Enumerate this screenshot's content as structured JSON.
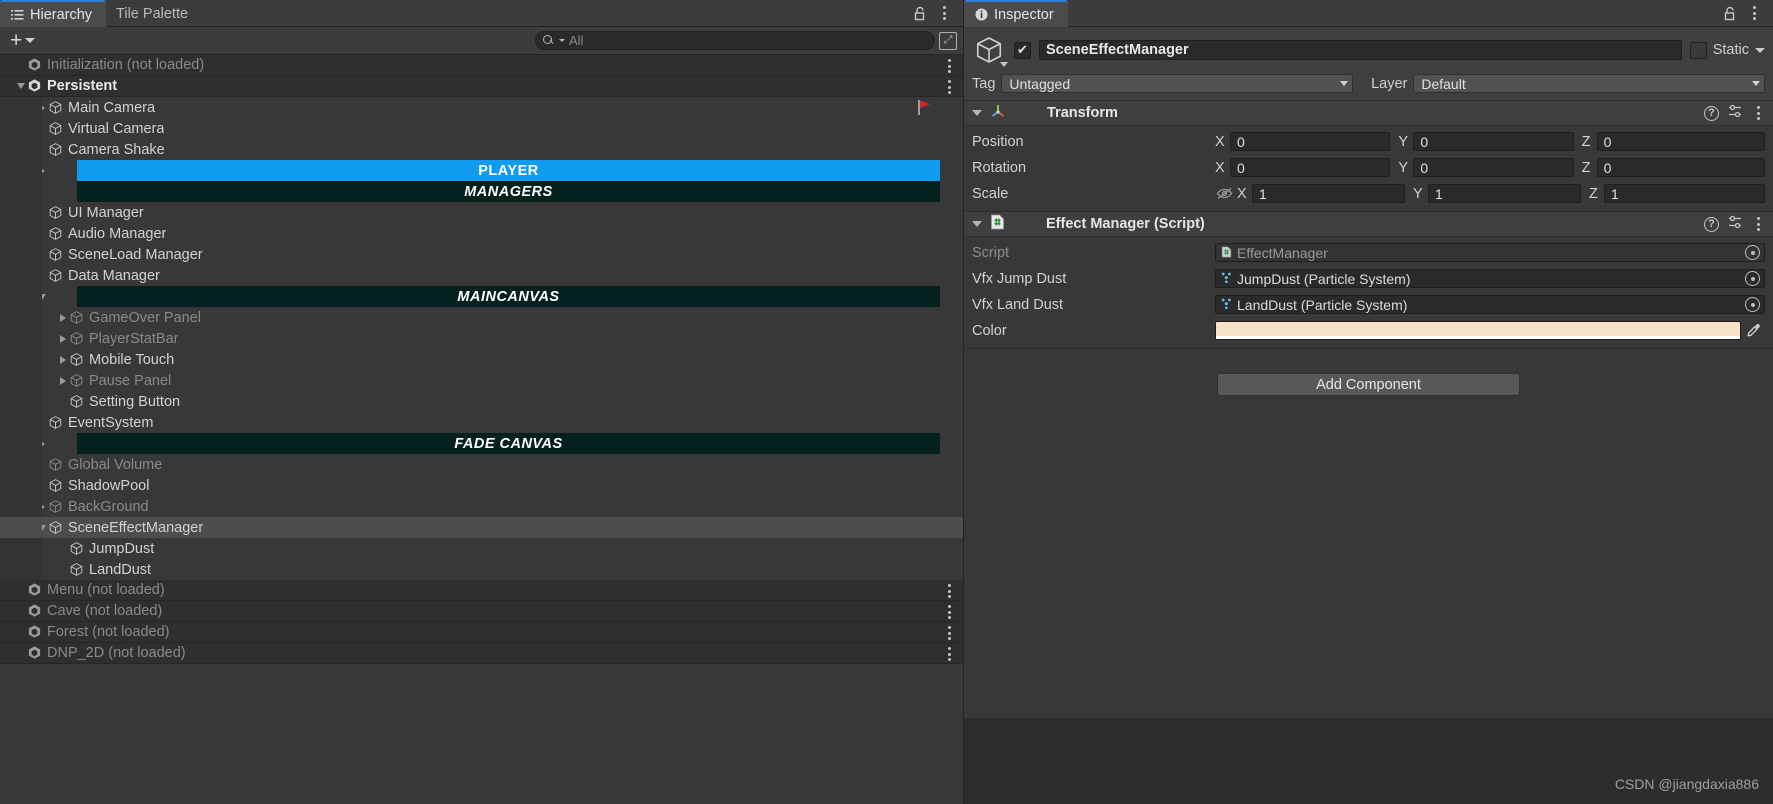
{
  "hierarchy": {
    "tabs": [
      {
        "label": "Hierarchy",
        "icon": "hierarchy-list-icon",
        "active": true
      },
      {
        "label": "Tile Palette",
        "icon": "tile-palette-icon",
        "active": false
      }
    ],
    "lock_icon": "lock-open-icon",
    "menu_icon": "kebab-menu-icon",
    "toolbar": {
      "add_label": "+",
      "add_icon": "plus-icon",
      "dropdown_icon": "chevron-down-icon"
    },
    "search": {
      "placeholder": "All",
      "value": "",
      "icon": "search-icon",
      "expand_icon": "expand-search-icon"
    },
    "rows": [
      {
        "label": "Initialization (not loaded)",
        "type": "scene",
        "depth": 0,
        "dim": true,
        "tri": "none",
        "icon": "unity-scene-icon",
        "kebab": true
      },
      {
        "label": "Persistent",
        "type": "scene-loaded",
        "depth": 0,
        "dim": false,
        "tri": "open",
        "icon": "unity-scene-icon",
        "kebab": true
      },
      {
        "label": "Main Camera",
        "type": "go",
        "depth": 1,
        "dim": false,
        "tri": "closed",
        "icon": "gameobject-icon",
        "flag": "camera-preview-flag"
      },
      {
        "label": "Virtual Camera",
        "type": "go",
        "depth": 1,
        "dim": false,
        "tri": "none",
        "icon": "gameobject-icon"
      },
      {
        "label": "Camera Shake",
        "type": "go",
        "depth": 1,
        "dim": false,
        "tri": "none",
        "icon": "gameobject-icon"
      },
      {
        "label": "PLAYER",
        "type": "banner-blue",
        "depth": 1,
        "dim": false,
        "tri": "closed",
        "icon": "none"
      },
      {
        "label": "MANAGERS",
        "type": "banner-teal",
        "depth": 1,
        "dim": false,
        "tri": "none",
        "icon": "none"
      },
      {
        "label": "UI Manager",
        "type": "go",
        "depth": 1,
        "dim": false,
        "tri": "none",
        "icon": "gameobject-icon"
      },
      {
        "label": "Audio Manager",
        "type": "go",
        "depth": 1,
        "dim": false,
        "tri": "none",
        "icon": "gameobject-icon"
      },
      {
        "label": "SceneLoad Manager",
        "type": "go",
        "depth": 1,
        "dim": false,
        "tri": "none",
        "icon": "gameobject-icon"
      },
      {
        "label": "Data Manager",
        "type": "go",
        "depth": 1,
        "dim": false,
        "tri": "none",
        "icon": "gameobject-icon"
      },
      {
        "label": "MAINCANVAS",
        "type": "banner-teal",
        "depth": 1,
        "dim": false,
        "tri": "open",
        "icon": "none"
      },
      {
        "label": "GameOver Panel",
        "type": "go",
        "depth": 2,
        "dim": true,
        "tri": "closed",
        "icon": "gameobject-icon"
      },
      {
        "label": "PlayerStatBar",
        "type": "go",
        "depth": 2,
        "dim": true,
        "tri": "closed",
        "icon": "gameobject-icon"
      },
      {
        "label": "Mobile Touch",
        "type": "go",
        "depth": 2,
        "dim": false,
        "tri": "closed",
        "icon": "gameobject-icon"
      },
      {
        "label": "Pause Panel",
        "type": "go",
        "depth": 2,
        "dim": true,
        "tri": "closed",
        "icon": "gameobject-icon"
      },
      {
        "label": "Setting Button",
        "type": "go",
        "depth": 2,
        "dim": false,
        "tri": "none",
        "icon": "gameobject-icon"
      },
      {
        "label": "EventSystem",
        "type": "go",
        "depth": 1,
        "dim": false,
        "tri": "none",
        "icon": "gameobject-icon"
      },
      {
        "label": "FADE CANVAS",
        "type": "banner-teal",
        "depth": 1,
        "dim": false,
        "tri": "closed",
        "icon": "none"
      },
      {
        "label": "Global Volume",
        "type": "go",
        "depth": 1,
        "dim": true,
        "tri": "none",
        "icon": "gameobject-icon"
      },
      {
        "label": "ShadowPool",
        "type": "go",
        "depth": 1,
        "dim": false,
        "tri": "none",
        "icon": "gameobject-icon"
      },
      {
        "label": "BackGround",
        "type": "go",
        "depth": 1,
        "dim": true,
        "tri": "closed",
        "icon": "gameobject-icon"
      },
      {
        "label": "SceneEffectManager",
        "type": "go-selected",
        "depth": 1,
        "dim": false,
        "tri": "open",
        "icon": "gameobject-icon"
      },
      {
        "label": "JumpDust",
        "type": "go",
        "depth": 2,
        "dim": false,
        "tri": "none",
        "icon": "gameobject-icon"
      },
      {
        "label": "LandDust",
        "type": "go",
        "depth": 2,
        "dim": false,
        "tri": "none",
        "icon": "gameobject-icon"
      },
      {
        "label": "Menu (not loaded)",
        "type": "scene",
        "depth": 0,
        "dim": true,
        "tri": "none",
        "icon": "unity-scene-icon",
        "kebab": true
      },
      {
        "label": "Cave (not loaded)",
        "type": "scene",
        "depth": 0,
        "dim": true,
        "tri": "none",
        "icon": "unity-scene-icon",
        "kebab": true
      },
      {
        "label": "Forest (not loaded)",
        "type": "scene",
        "depth": 0,
        "dim": true,
        "tri": "none",
        "icon": "unity-scene-icon",
        "kebab": true
      },
      {
        "label": "DNP_2D (not loaded)",
        "type": "scene",
        "depth": 0,
        "dim": true,
        "tri": "none",
        "icon": "unity-scene-icon",
        "kebab": true
      }
    ]
  },
  "inspector": {
    "tab_label": "Inspector",
    "tab_icon": "info-icon",
    "lock_icon": "lock-open-icon",
    "menu_icon": "kebab-menu-icon",
    "game_object": {
      "enabled": true,
      "icon": "gameobject-icon",
      "name": "SceneEffectManager",
      "static_label": "Static",
      "static_checked": false,
      "tag_label": "Tag",
      "tag_value": "Untagged",
      "layer_label": "Layer",
      "layer_value": "Default"
    },
    "components": [
      {
        "title": "Transform",
        "icon": "transform-axis-icon",
        "expanded": true,
        "help_icon": "help-icon",
        "preset_icon": "preset-icon",
        "menu_icon": "kebab-menu-icon",
        "rows": [
          {
            "kind": "vector3",
            "label": "Position",
            "x": "0",
            "y": "0",
            "z": "0",
            "hidden_eye": false
          },
          {
            "kind": "vector3",
            "label": "Rotation",
            "x": "0",
            "y": "0",
            "z": "0",
            "hidden_eye": false
          },
          {
            "kind": "vector3",
            "label": "Scale",
            "x": "1",
            "y": "1",
            "z": "1",
            "hidden_eye": true,
            "eye_icon": "eye-off-icon"
          }
        ]
      },
      {
        "title": "Effect Manager (Script)",
        "icon": "csharp-script-icon",
        "expanded": true,
        "help_icon": "help-icon",
        "preset_icon": "preset-icon",
        "menu_icon": "kebab-menu-icon",
        "rows": [
          {
            "kind": "object",
            "label": "Script",
            "value": "EffectManager",
            "value_icon": "csharp-script-icon",
            "dimmed": true,
            "picker_icon": "object-picker-icon"
          },
          {
            "kind": "object",
            "label": "Vfx Jump Dust",
            "value": "JumpDust (Particle System)",
            "value_icon": "particle-system-icon",
            "dimmed": false,
            "picker_icon": "object-picker-icon"
          },
          {
            "kind": "object",
            "label": "Vfx Land Dust",
            "value": "LandDust (Particle System)",
            "value_icon": "particle-system-icon",
            "dimmed": false,
            "picker_icon": "object-picker-icon"
          },
          {
            "kind": "color",
            "label": "Color",
            "color": "#F7E3C6",
            "eyedropper_icon": "eyedropper-icon"
          }
        ]
      }
    ],
    "add_component_label": "Add Component"
  },
  "watermark": "CSDN @jiangdaxia886",
  "theme": {
    "panel_bg": "#383838",
    "selection_blue": "#2c5d87",
    "banner_blue": "#0f9bef",
    "banner_teal": "#04211f",
    "accent_tab": "#2b7fd4"
  }
}
